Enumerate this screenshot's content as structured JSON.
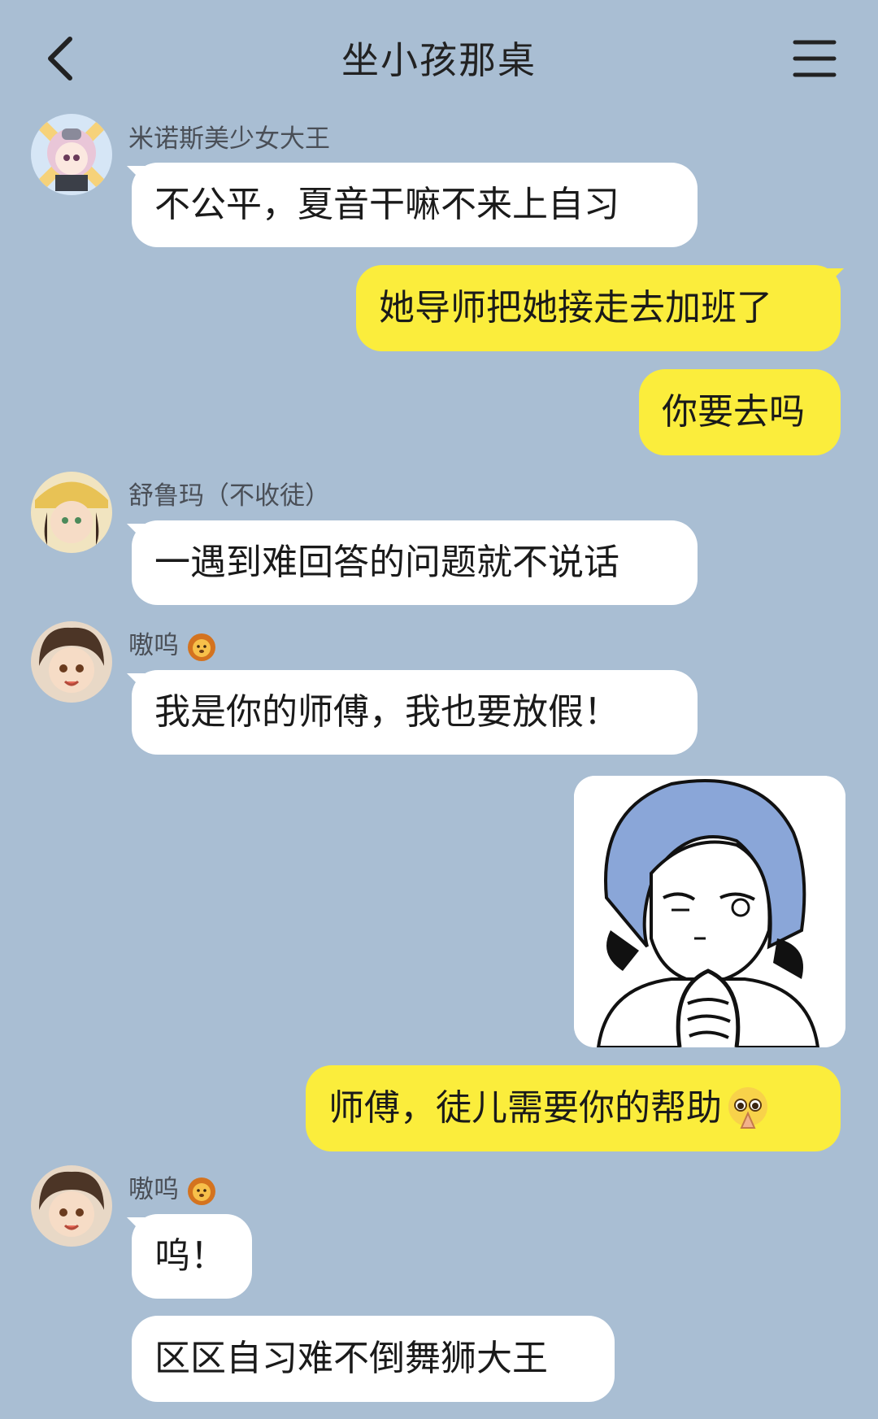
{
  "header": {
    "title": "坐小孩那桌",
    "back_icon": "chevron-left-icon",
    "menu_icon": "hamburger-menu-icon"
  },
  "messages": [
    {
      "sender": "米诺斯美少女大王",
      "text": "不公平，夏音干嘛不来上自习"
    },
    {
      "text": "她导师把她接走去加班了"
    },
    {
      "text": "你要去吗"
    },
    {
      "sender": "舒鲁玛（不收徒）",
      "text": "一遇到难回答的问题就不说话"
    },
    {
      "sender": "嗷呜",
      "sender_emoji": "lion-face-emoji",
      "text": "我是你的师傅，我也要放假！"
    },
    {
      "sticker": "praying-girl-sticker"
    },
    {
      "text": "师傅，徒儿需要你的帮助",
      "emoji": "pleading-face-with-folded-hands-emoji"
    },
    {
      "sender": "嗷呜",
      "sender_emoji": "lion-face-emoji",
      "text": "呜！"
    },
    {
      "text": "区区自习难不倒舞狮大王"
    }
  ],
  "colors": {
    "background": "#a9bed3",
    "incoming_bubble": "#ffffff",
    "outgoing_bubble": "#fbed3c",
    "sender_name": "#4a4f57"
  }
}
